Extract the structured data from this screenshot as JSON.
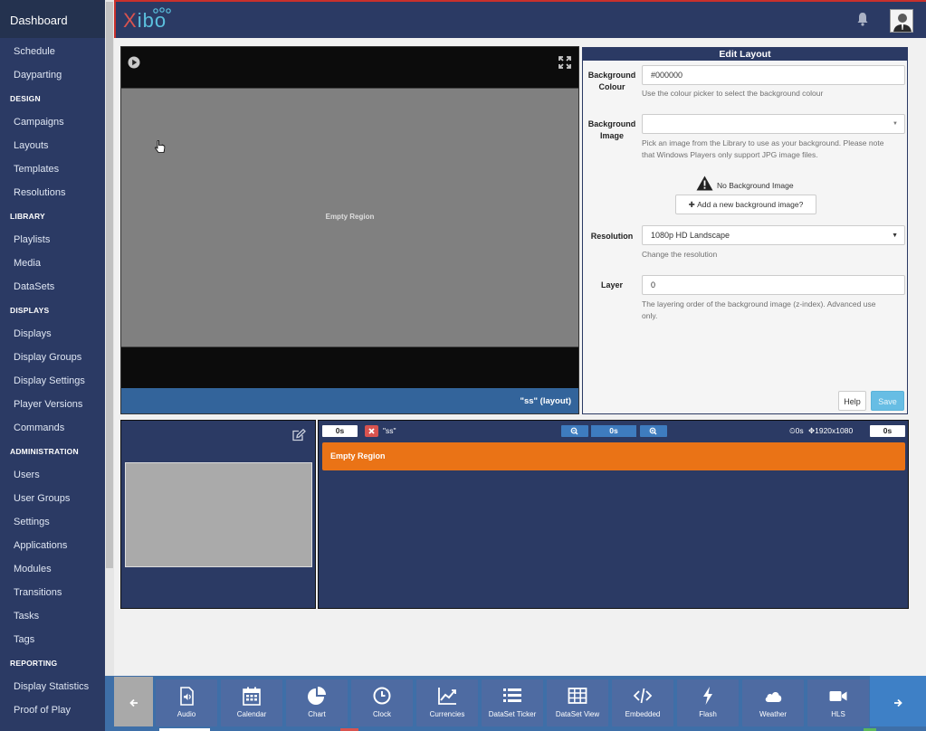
{
  "sidebar": {
    "brand": "Dashboard",
    "items": [
      {
        "type": "item",
        "label": "Schedule"
      },
      {
        "type": "item",
        "label": "Dayparting"
      },
      {
        "type": "header",
        "label": "DESIGN"
      },
      {
        "type": "item",
        "label": "Campaigns"
      },
      {
        "type": "item",
        "label": "Layouts"
      },
      {
        "type": "item",
        "label": "Templates"
      },
      {
        "type": "item",
        "label": "Resolutions"
      },
      {
        "type": "header",
        "label": "LIBRARY"
      },
      {
        "type": "item",
        "label": "Playlists"
      },
      {
        "type": "item",
        "label": "Media"
      },
      {
        "type": "item",
        "label": "DataSets"
      },
      {
        "type": "header",
        "label": "DISPLAYS"
      },
      {
        "type": "item",
        "label": "Displays"
      },
      {
        "type": "item",
        "label": "Display Groups"
      },
      {
        "type": "item",
        "label": "Display Settings"
      },
      {
        "type": "item",
        "label": "Player Versions"
      },
      {
        "type": "item",
        "label": "Commands"
      },
      {
        "type": "header",
        "label": "ADMINISTRATION"
      },
      {
        "type": "item",
        "label": "Users"
      },
      {
        "type": "item",
        "label": "User Groups"
      },
      {
        "type": "item",
        "label": "Settings"
      },
      {
        "type": "item",
        "label": "Applications"
      },
      {
        "type": "item",
        "label": "Modules"
      },
      {
        "type": "item",
        "label": "Transitions"
      },
      {
        "type": "item",
        "label": "Tasks"
      },
      {
        "type": "item",
        "label": "Tags"
      },
      {
        "type": "header",
        "label": "REPORTING"
      },
      {
        "type": "item",
        "label": "Display Statistics"
      },
      {
        "type": "item",
        "label": "Proof of Play"
      }
    ]
  },
  "topbar": {
    "logo_x": "X",
    "logo_i": "i",
    "logo_bo": "bo",
    "bell_icon": "bell-icon",
    "avatar": "user-avatar"
  },
  "viewer": {
    "region_label": "Empty Region",
    "footer": "\"ss\" (layout)",
    "play_icon": "play-icon",
    "fullscreen_icon": "expand-icon"
  },
  "edit_layout": {
    "title": "Edit Layout",
    "background_colour": {
      "label_1": "Background",
      "label_2": "Colour",
      "value": "#000000",
      "help": "Use the colour picker to select the background colour"
    },
    "background_image": {
      "label_1": "Background",
      "label_2": "Image",
      "value": "",
      "help_1": "Pick an image from the Library to use as your background. Please note",
      "help_2": "that Windows Players only support JPG image files.",
      "no_image": "No Background Image",
      "add_button": "Add a new background image?"
    },
    "resolution": {
      "label": "Resolution",
      "value": "1080p HD Landscape",
      "help": "Change the resolution"
    },
    "layer": {
      "label": "Layer",
      "value": "0",
      "help_1": "The layering order of the background image (z-index). Advanced use",
      "help_2": "only."
    },
    "help_button": "Help",
    "save_button": "Save"
  },
  "timeline": {
    "duration": "0s",
    "layout_name": "\"ss\"",
    "zoom_value": "0s",
    "info_duration": "0s",
    "info_resolution": "1920x1080",
    "end_duration": "0s",
    "region_name": "Empty Region"
  },
  "toolbox": {
    "tools": [
      {
        "label": "Audio",
        "icon": "audio-file-icon"
      },
      {
        "label": "Calendar",
        "icon": "calendar-icon"
      },
      {
        "label": "Chart",
        "icon": "pie-chart-icon"
      },
      {
        "label": "Clock",
        "icon": "clock-icon"
      },
      {
        "label": "Currencies",
        "icon": "line-chart-icon"
      },
      {
        "label": "DataSet Ticker",
        "icon": "list-icon"
      },
      {
        "label": "DataSet View",
        "icon": "table-icon"
      },
      {
        "label": "Embedded",
        "icon": "code-icon"
      },
      {
        "label": "Flash",
        "icon": "bolt-icon"
      },
      {
        "label": "Weather",
        "icon": "cloud-icon"
      },
      {
        "label": "HLS",
        "icon": "video-camera-icon"
      }
    ]
  },
  "colors": {
    "sidebar_bg": "#2b3a64",
    "region_orange": "#ea7316",
    "save_blue": "#67bde4",
    "accent_red": "#d9534f"
  }
}
